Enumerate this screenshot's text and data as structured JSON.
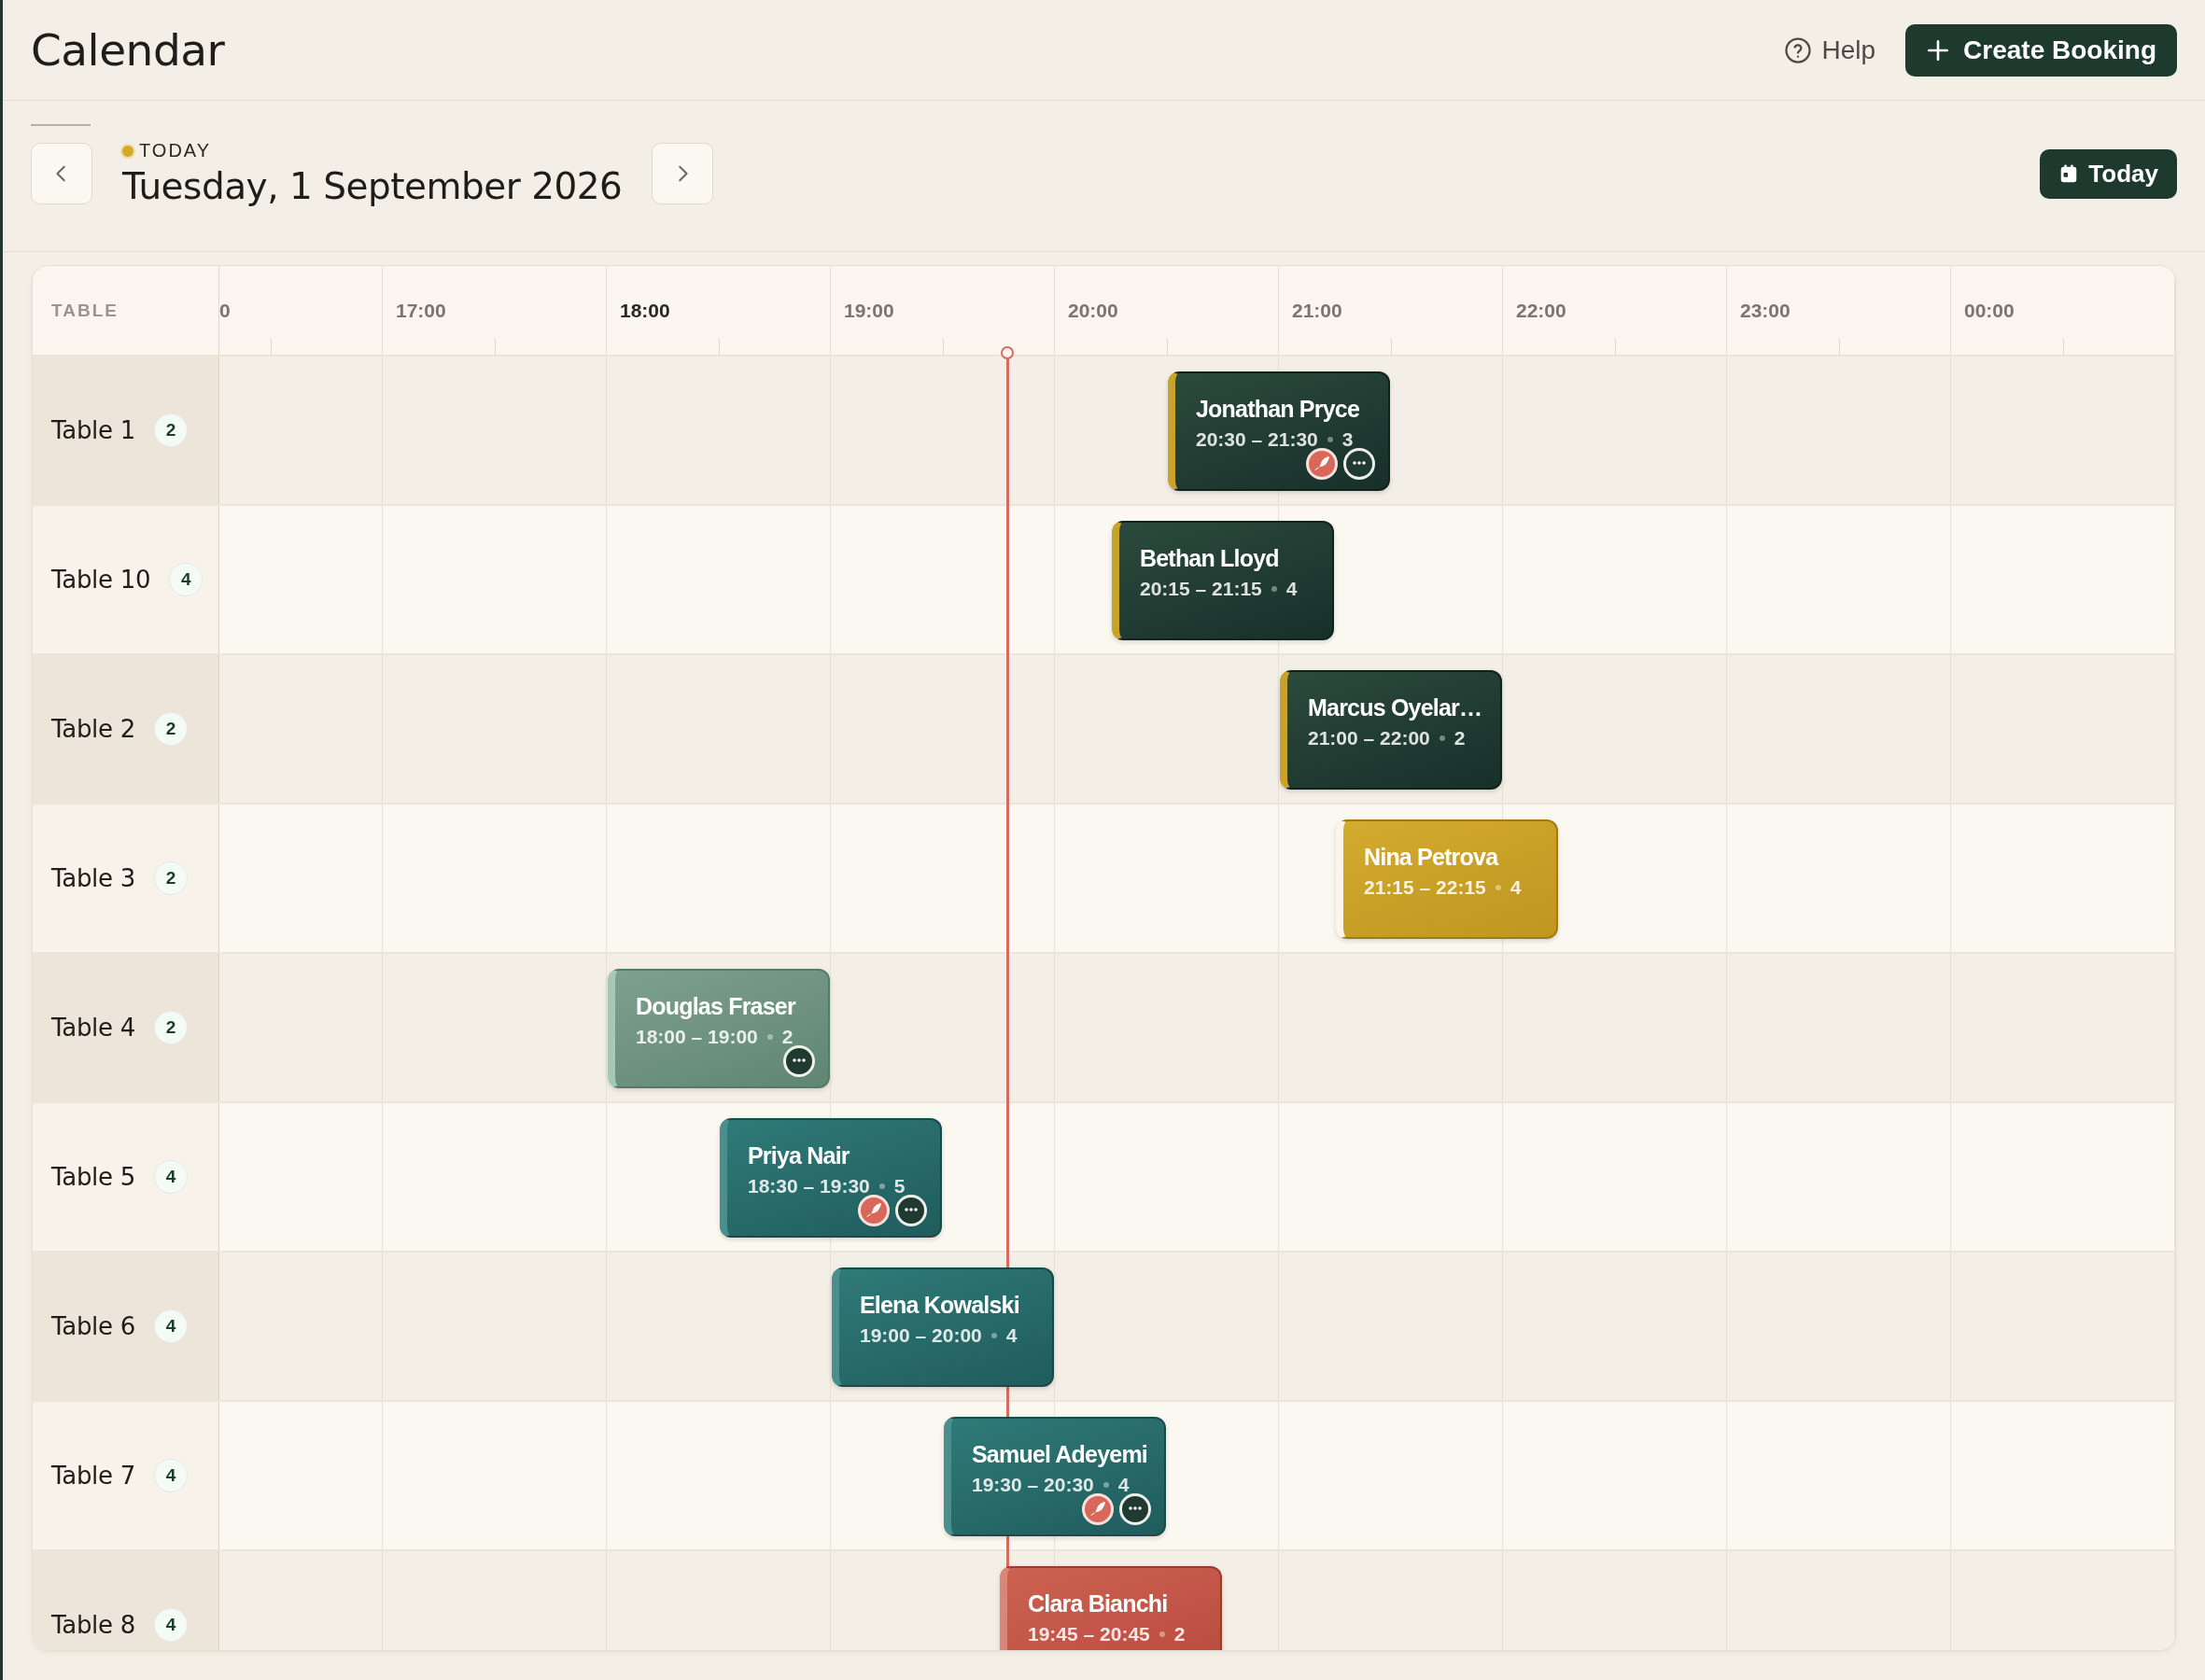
{
  "page_title": "Calendar",
  "help": {
    "label": "Help"
  },
  "create_button": {
    "label": "Create Booking"
  },
  "date_bar": {
    "badge": "TODAY",
    "date": "Tuesday, 1 September 2026",
    "today_button": "Today"
  },
  "calendar": {
    "column_header": "TABLE",
    "hours": [
      {
        "label": "0",
        "highlighted": false
      },
      {
        "label": "17:00",
        "highlighted": false
      },
      {
        "label": "18:00",
        "highlighted": true
      },
      {
        "label": "19:00",
        "highlighted": false
      },
      {
        "label": "20:00",
        "highlighted": false
      },
      {
        "label": "21:00",
        "highlighted": false
      },
      {
        "label": "22:00",
        "highlighted": false
      },
      {
        "label": "23:00",
        "highlighted": false
      },
      {
        "label": "00:00",
        "highlighted": false
      }
    ],
    "now_line": {
      "level": 0.403
    },
    "rows": [
      {
        "table": "Table 1",
        "seats": "2",
        "bookings": [
          {
            "name": "Jonathan Pryce",
            "time": "20:30 – 21:30",
            "party": "3",
            "kind": "dark",
            "dietary": true,
            "note": true
          }
        ]
      },
      {
        "table": "Table 10",
        "seats": "4",
        "bookings": [
          {
            "name": "Bethan Lloyd",
            "time": "20:15 – 21:15",
            "party": "4",
            "kind": "dark",
            "dietary": false,
            "note": false
          }
        ]
      },
      {
        "table": "Table 2",
        "seats": "2",
        "bookings": [
          {
            "name": "Marcus Oyelar…",
            "time": "21:00 – 22:00",
            "party": "2",
            "kind": "dark",
            "dietary": false,
            "note": false
          }
        ]
      },
      {
        "table": "Table 3",
        "seats": "2",
        "bookings": [
          {
            "name": "Nina Petrova",
            "time": "21:15 – 22:15",
            "party": "4",
            "kind": "gold",
            "dietary": false,
            "note": false
          }
        ]
      },
      {
        "table": "Table 4",
        "seats": "2",
        "bookings": [
          {
            "name": "Douglas Fraser",
            "time": "18:00 – 19:00",
            "party": "2",
            "kind": "sage",
            "dietary": false,
            "note": true
          }
        ]
      },
      {
        "table": "Table 5",
        "seats": "4",
        "bookings": [
          {
            "name": "Priya Nair",
            "time": "18:30 – 19:30",
            "party": "5",
            "kind": "teal",
            "dietary": true,
            "note": true
          }
        ]
      },
      {
        "table": "Table 6",
        "seats": "4",
        "bookings": [
          {
            "name": "Elena Kowalski",
            "time": "19:00 – 20:00",
            "party": "4",
            "kind": "teal",
            "dietary": false,
            "note": false
          }
        ]
      },
      {
        "table": "Table 7",
        "seats": "4",
        "bookings": [
          {
            "name": "Samuel Adeyemi",
            "time": "19:30 – 20:30",
            "party": "4",
            "kind": "teal",
            "dietary": true,
            "note": true
          }
        ]
      },
      {
        "table": "Table 8",
        "seats": "4",
        "bookings": [
          {
            "name": "Clara Bianchi",
            "time": "19:45 – 20:45",
            "party": "2",
            "kind": "red",
            "dietary": false,
            "note": false
          }
        ]
      }
    ]
  }
}
